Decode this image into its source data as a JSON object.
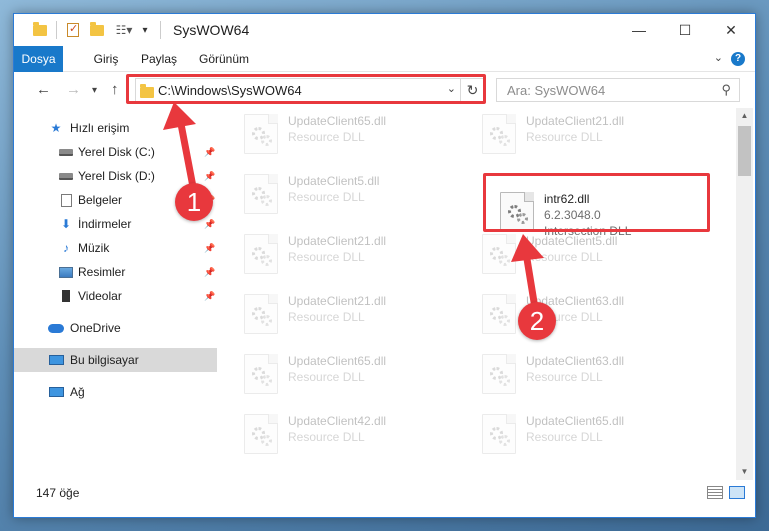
{
  "window": {
    "title": "SysWOW64",
    "controls": {
      "minimize": "—",
      "maximize": "☐",
      "close": "✕"
    }
  },
  "quick_access_toolbar": {
    "icons": [
      "folder-icon",
      "properties-icon",
      "new-folder-icon",
      "view-options-icon"
    ],
    "customize_arrow": "▾"
  },
  "ribbon": {
    "tabs": [
      {
        "label": "Dosya",
        "active": true
      },
      {
        "label": "Giriş",
        "active": false
      },
      {
        "label": "Paylaş",
        "active": false
      },
      {
        "label": "Görünüm",
        "active": false
      }
    ],
    "help": "?"
  },
  "navigation": {
    "back": "←",
    "forward": "→",
    "recent": "▾",
    "up": "↑",
    "address": "C:\\Windows\\SysWOW64",
    "refresh": "↻",
    "search_placeholder": "Ara: SysWOW64"
  },
  "sidebar": {
    "items": [
      {
        "label": "Hızlı erişim",
        "icon": "star-icon",
        "pinned": false
      },
      {
        "label": "Yerel Disk (C:)",
        "icon": "disk-icon",
        "pinned": true
      },
      {
        "label": "Yerel Disk (D:)",
        "icon": "disk-icon",
        "pinned": true
      },
      {
        "label": "Belgeler",
        "icon": "documents-icon",
        "pinned": true
      },
      {
        "label": "İndirmeler",
        "icon": "download-icon",
        "pinned": true
      },
      {
        "label": "Müzik",
        "icon": "music-icon",
        "pinned": true
      },
      {
        "label": "Resimler",
        "icon": "pictures-icon",
        "pinned": true
      },
      {
        "label": "Videolar",
        "icon": "videos-icon",
        "pinned": true
      },
      {
        "label": "OneDrive",
        "icon": "cloud-icon",
        "pinned": false
      },
      {
        "label": "Bu bilgisayar",
        "icon": "computer-icon",
        "pinned": false,
        "selected": true
      },
      {
        "label": "Ağ",
        "icon": "network-icon",
        "pinned": false
      }
    ]
  },
  "files": [
    {
      "name": "UpdateClient65.dll",
      "type": "Resource DLL",
      "faded": true
    },
    {
      "name": "UpdateClient21.dll",
      "type": "Resource DLL",
      "faded": true
    },
    {
      "name": "UpdateClient5.dll",
      "type": "Resource DLL",
      "faded": true
    },
    {
      "name": "intr62.dll",
      "type": "6.2.3048.0",
      "company": "Intersection DLL",
      "faded": false,
      "highlighted": true
    },
    {
      "name": "UpdateClient21.dll",
      "type": "Resource DLL",
      "faded": true
    },
    {
      "name": "UpdateClient5.dll",
      "type": "Resource DLL",
      "faded": true
    },
    {
      "name": "UpdateClient21.dll",
      "type": "Resource DLL",
      "faded": true
    },
    {
      "name": "UpdateClient63.dll",
      "type": "Resource DLL",
      "faded": true
    },
    {
      "name": "UpdateClient65.dll",
      "type": "Resource DLL",
      "faded": true
    },
    {
      "name": "UpdateClient63.dll",
      "type": "Resource DLL",
      "faded": true
    },
    {
      "name": "UpdateClient42.dll",
      "type": "Resource DLL",
      "faded": true
    },
    {
      "name": "UpdateClient65.dll",
      "type": "Resource DLL",
      "faded": true
    }
  ],
  "status": {
    "item_count": "147 öğe"
  },
  "callouts": [
    {
      "number": "1"
    },
    {
      "number": "2"
    }
  ],
  "colors": {
    "accent": "#1979ca",
    "highlight_red": "#e8383d"
  }
}
